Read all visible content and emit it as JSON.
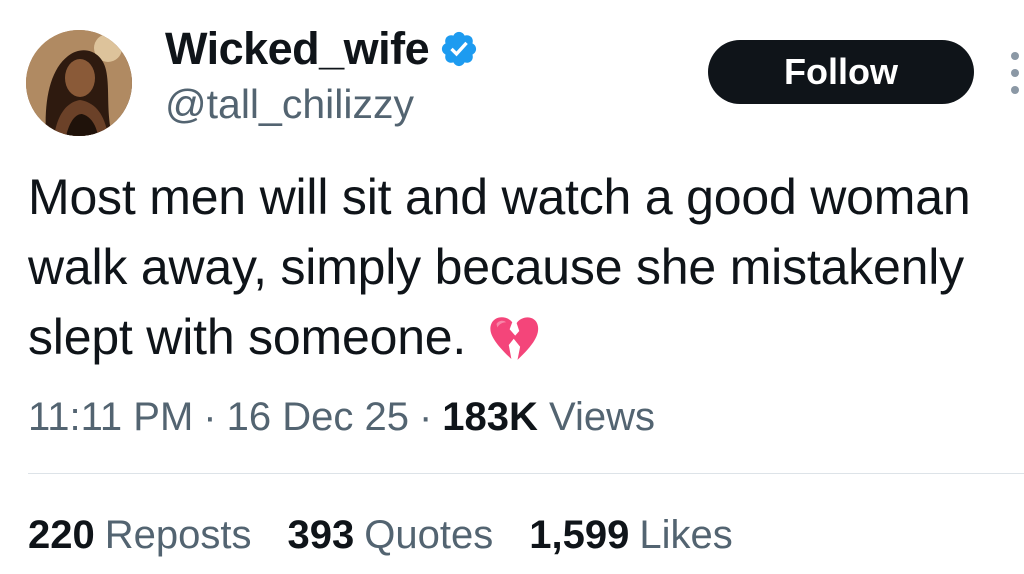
{
  "author": {
    "display_name": "Wicked_wife",
    "handle": "@tall_chilizzy",
    "verified": true,
    "verified_color": "#1d9bf0",
    "avatar_icon": "profile-photo"
  },
  "follow_button": {
    "label": "Follow",
    "bg_color": "#0f1419"
  },
  "more_options_icon": "vertical-ellipsis-icon",
  "tweet": {
    "text": "Most men will sit and watch a good woman walk away, simply because she mistakenly slept with someone.",
    "emoji": "broken-heart-icon",
    "emoji_color": "#f4457a"
  },
  "meta": {
    "time": "11:11 PM",
    "separator": "·",
    "date": "16 Dec 25",
    "views_count": "183K",
    "views_label": "Views"
  },
  "stats": [
    {
      "count": "220",
      "label": "Reposts"
    },
    {
      "count": "393",
      "label": "Quotes"
    },
    {
      "count": "1,599",
      "label": "Likes"
    }
  ]
}
